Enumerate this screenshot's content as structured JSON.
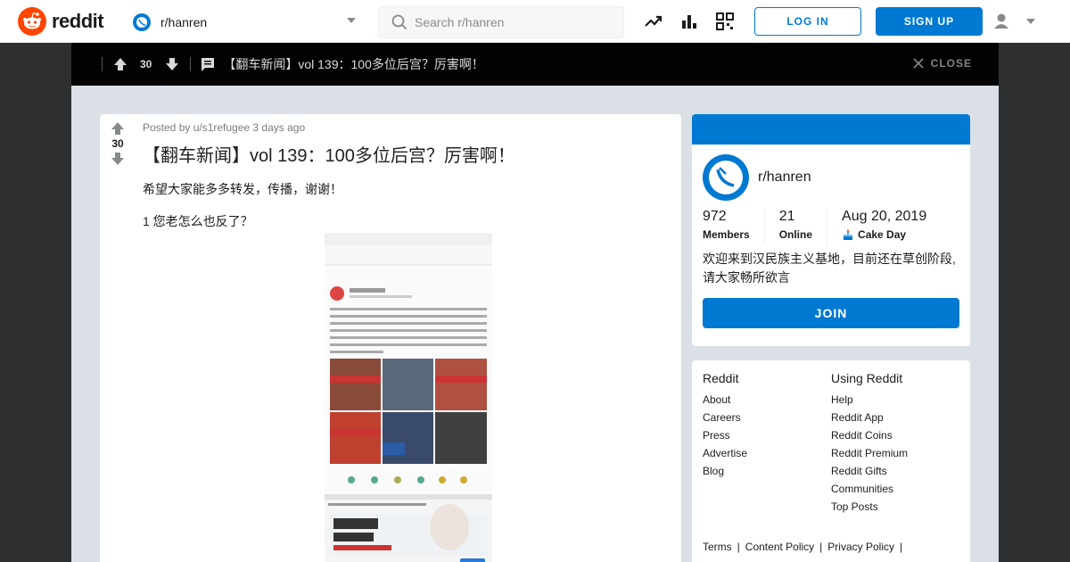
{
  "header": {
    "logo_text": "reddit",
    "subreddit": "r/hanren",
    "search_placeholder": "Search r/hanren",
    "login_label": "LOG IN",
    "signup_label": "SIGN UP"
  },
  "postbar": {
    "score": "30",
    "title": "【翻车新闻】vol 139：100多位后宫？厉害啊！",
    "close_label": "CLOSE"
  },
  "post": {
    "score": "30",
    "meta": "Posted by u/s1refugee 3 days ago",
    "title": "【翻车新闻】vol 139：100多位后宫？厉害啊！",
    "body_line1": "希望大家能多多转发，传播，谢谢！",
    "body_line2": "1 您老怎么也反了？"
  },
  "sidebar": {
    "community_name": "r/hanren",
    "members_count": "972",
    "members_label": "Members",
    "online_count": "21",
    "online_label": "Online",
    "cake_date": "Aug 20, 2019",
    "cake_label": "Cake Day",
    "description": "欢迎来到汉民族主义基地，目前还在草创阶段,请大家畅所欲言",
    "join_label": "JOIN"
  },
  "footer": {
    "col1_title": "Reddit",
    "col1_links": [
      "About",
      "Careers",
      "Press",
      "Advertise",
      "Blog"
    ],
    "col2_title": "Using Reddit",
    "col2_links": [
      "Help",
      "Reddit App",
      "Reddit Coins",
      "Reddit Premium",
      "Reddit Gifts",
      "Communities",
      "Top Posts"
    ],
    "bottom_links": [
      "Terms",
      "Content Policy",
      "Privacy Policy"
    ]
  },
  "colors": {
    "accent": "#0079d3",
    "brand": "#ff4500",
    "bar": "#030303",
    "page_bg": "#dae0e6"
  }
}
